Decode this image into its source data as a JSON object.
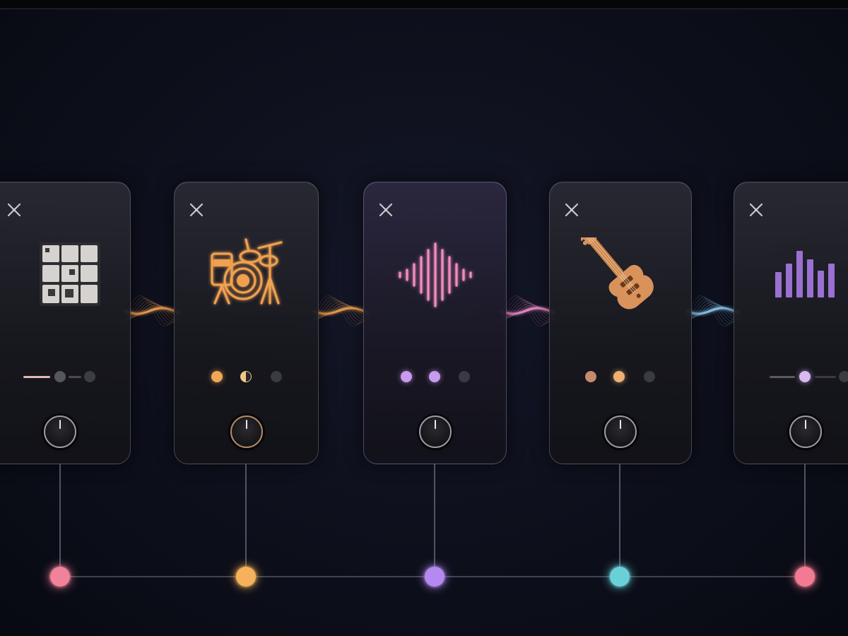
{
  "window": {
    "title": ""
  },
  "channels": [
    {
      "name": "pad-grid",
      "icon": "pad-grid-icon",
      "accent": "#c7c2c0",
      "controls": "slider",
      "slider_value": 0.55,
      "knob_icon": "knob-icon",
      "node_color": "#f0829a"
    },
    {
      "name": "drum-kit",
      "icon": "drum-kit-icon",
      "accent": "#f0a050",
      "controls": "dots",
      "dot_colors": [
        "#f2a654",
        "#f2c886",
        "#3a3a42"
      ],
      "knob_icon": "knob-icon",
      "node_color": "#f5b15c"
    },
    {
      "name": "waveform",
      "icon": "waveform-icon",
      "accent": "#f28cc0",
      "controls": "dots",
      "dot_colors": [
        "#c89af0",
        "#c89af0",
        "#3a3a42"
      ],
      "knob_icon": "knob-icon",
      "node_color": "#b48af0"
    },
    {
      "name": "bass-guitar",
      "icon": "bass-guitar-icon",
      "accent": "#d9925a",
      "controls": "dots",
      "dot_colors": [
        "#c48a6c",
        "#f0b070",
        "#3a3a42"
      ],
      "knob_icon": "knob-icon",
      "node_color": "#6ad0d8"
    },
    {
      "name": "equalizer",
      "icon": "equalizer-bars-icon",
      "accent": "#9a70d0",
      "controls": "slider",
      "slider_value": 0.55,
      "knob_icon": "knob-icon",
      "node_color": "#f27a92"
    }
  ],
  "wave_colors": [
    "#f0a050",
    "#f0a050",
    "#f08cc8",
    "#8ac8f0"
  ]
}
